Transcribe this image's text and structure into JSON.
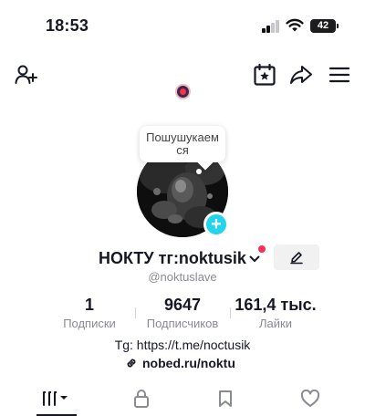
{
  "status_bar": {
    "time": "18:53",
    "battery": "42"
  },
  "nav": {
    "icons": [
      "add-friend-icon",
      "calendar-star-icon",
      "share-icon",
      "menu-icon"
    ]
  },
  "tooltip": {
    "text": "Пошушукаемся"
  },
  "profile": {
    "display_name": "НОКТУ тг:noktusik",
    "username": "@noktuslave",
    "add_avatar_symbol": "+"
  },
  "stats": [
    {
      "value": "1",
      "label": "Подписки"
    },
    {
      "value": "9647",
      "label": "Подписчиков"
    },
    {
      "value": "161,4 тыс.",
      "label": "Лайки"
    }
  ],
  "bio": {
    "line": "Tg: https://t.me/noctusik",
    "link": "nobed.ru/noktu"
  },
  "colors": {
    "accent_red": "#fe2c55",
    "avatar_plus": "#20d5ec",
    "text_primary": "#161823",
    "text_secondary": "#8a8b91"
  }
}
